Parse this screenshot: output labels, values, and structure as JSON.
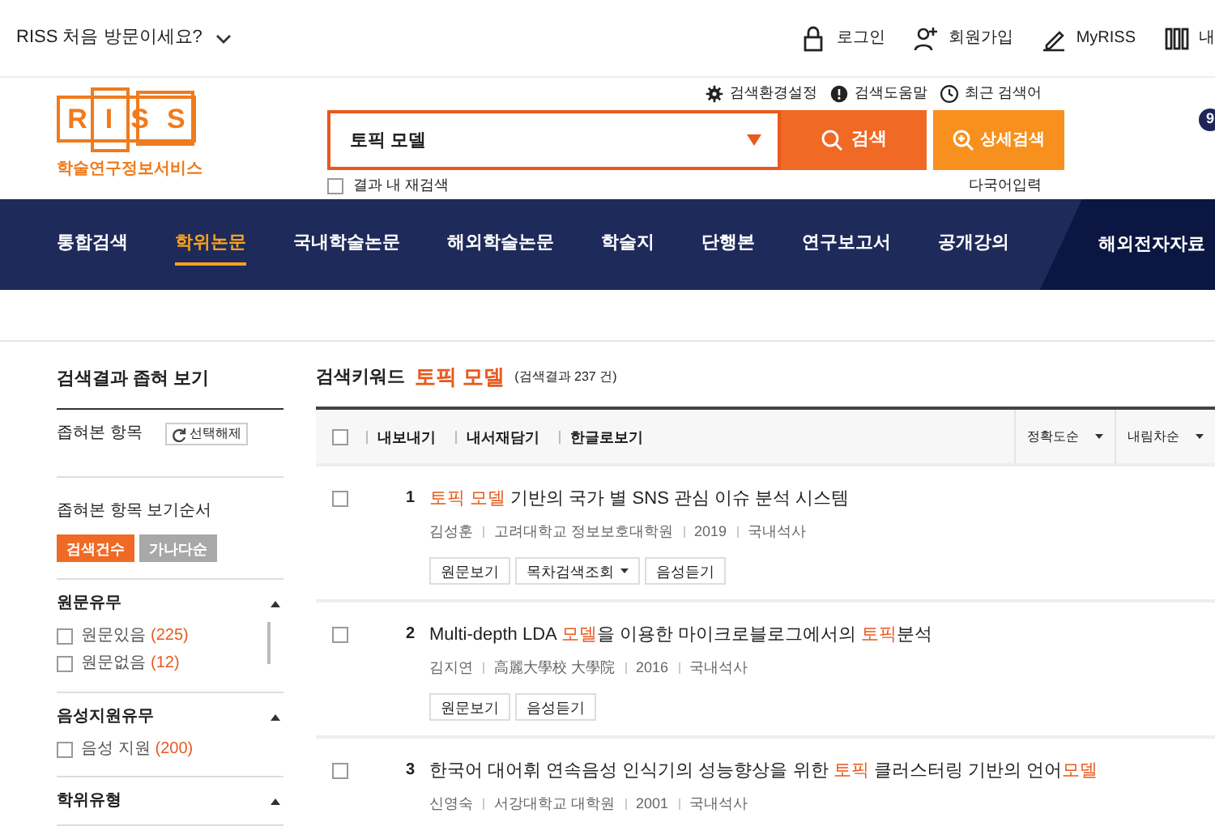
{
  "top_bar": {
    "welcome": "RISS 처음 방문이세요?",
    "links": [
      {
        "kind": "lock",
        "label": "로그인"
      },
      {
        "kind": "person",
        "label": "회원가입"
      },
      {
        "kind": "pen",
        "label": "MyRISS"
      },
      {
        "kind": "book",
        "label": "내"
      }
    ]
  },
  "header": {
    "logo_text": "RISS",
    "logo_subtitle": "학술연구정보서비스",
    "tools": [
      {
        "kind": "gear",
        "label": "검색환경설정"
      },
      {
        "kind": "info",
        "label": "검색도움말"
      },
      {
        "kind": "clock",
        "label": "최근 검색어"
      }
    ],
    "search": {
      "value": "토픽 모델",
      "button": "검색",
      "advanced_button": "상세검색",
      "research_checkbox": {
        "label": "결과 내 재검색",
        "checked": false
      },
      "multilang": "다국어입력"
    },
    "badge": "9"
  },
  "nav": [
    {
      "label": "통합검색",
      "selected": false
    },
    {
      "label": "학위논문",
      "selected": true
    },
    {
      "label": "국내학술논문",
      "selected": false
    },
    {
      "label": "해외학술논문",
      "selected": false
    },
    {
      "label": "학술지",
      "selected": false
    },
    {
      "label": "단행본",
      "selected": false
    },
    {
      "label": "연구보고서",
      "selected": false
    },
    {
      "label": "공개강의",
      "selected": false
    },
    {
      "label": "해외전자자료",
      "selected": false,
      "kind": "special"
    }
  ],
  "sidebar": {
    "title": "검색결과 좁혀 보기",
    "narrowed_label": "좁혀본 항목",
    "reset_button": "선택해제",
    "order_label": "좁혀본 항목 보기순서",
    "order_buttons": [
      {
        "label": "검색건수",
        "selected": true
      },
      {
        "label": "가나다순",
        "selected": false
      }
    ],
    "sections": [
      {
        "title": "원문유무",
        "expanded": true,
        "scroll": true,
        "options": [
          {
            "label": "원문있음",
            "count": "(225)",
            "checked": false
          },
          {
            "label": "원문없음",
            "count": "(12)",
            "checked": false
          }
        ]
      },
      {
        "title": "음성지원유무",
        "expanded": true,
        "scroll": false,
        "options": [
          {
            "label": "음성 지원",
            "count": "(200)",
            "checked": false
          }
        ]
      },
      {
        "title": "학위유형",
        "expanded": true
      }
    ]
  },
  "results": {
    "keyword_label": "검색키워드",
    "keyword": "토픽 모델",
    "count": "(검색결과 237 건)",
    "select_all": {
      "checked": false
    },
    "actions": [
      "내보내기",
      "내서재담기",
      "한글로보기"
    ],
    "sorts": [
      "정확도순",
      "내림차순"
    ],
    "items": [
      {
        "number": "1",
        "checked": false,
        "title": [
          {
            "text": "토픽 모델",
            "highlight": true
          },
          {
            "text": " 기반의 국가 별 SNS 관심 이슈 분석 시스템",
            "highlight": false
          }
        ],
        "meta": [
          "김성훈",
          "고려대학교 정보보호대학원",
          "2019",
          "국내석사"
        ],
        "buttons": [
          {
            "label": "원문보기",
            "menu": false
          },
          {
            "label": "목차검색조회",
            "menu": true
          },
          {
            "label": "음성듣기",
            "menu": false
          }
        ]
      },
      {
        "number": "2",
        "checked": false,
        "title": [
          {
            "text": "Multi-depth LDA ",
            "highlight": false
          },
          {
            "text": "모델",
            "highlight": true
          },
          {
            "text": "을 이용한 마이크로블로그에서의 ",
            "highlight": false
          },
          {
            "text": "토픽",
            "highlight": true
          },
          {
            "text": "분석",
            "highlight": false
          }
        ],
        "meta": [
          "김지연",
          "高麗大學校 大學院",
          "2016",
          "국내석사"
        ],
        "buttons": [
          {
            "label": "원문보기",
            "menu": false
          },
          {
            "label": "음성듣기",
            "menu": false
          }
        ]
      },
      {
        "number": "3",
        "checked": false,
        "title": [
          {
            "text": "한국어 대어휘 연속음성 인식기의 성능향상을 위한 ",
            "highlight": false
          },
          {
            "text": "토픽",
            "highlight": true
          },
          {
            "text": " 클러스터링 기반의 언어",
            "highlight": false
          },
          {
            "text": "모델",
            "highlight": true
          }
        ],
        "meta": [
          "신영숙",
          "서강대학교 대학원",
          "2001",
          "국내석사"
        ]
      }
    ]
  }
}
